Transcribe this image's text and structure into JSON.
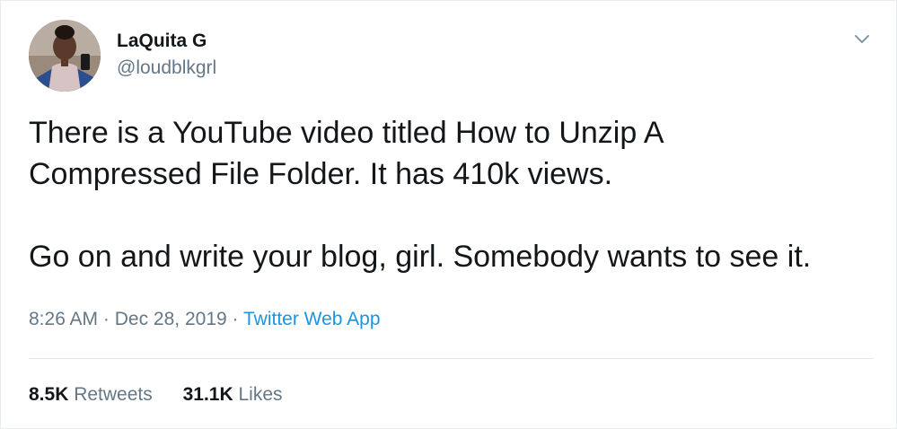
{
  "user": {
    "display_name": "LaQuita G",
    "handle": "@loudblkgrl"
  },
  "tweet": {
    "lines_paragraph_1": [
      "There is a YouTube video titled How to Unzip A",
      "Compressed File Folder. It has 410k views."
    ],
    "paragraph_2": "Go on and write your blog, girl. Somebody wants to see it.",
    "time": "8:26 AM",
    "separator": "·",
    "date": "Dec 28, 2019",
    "source": "Twitter Web App"
  },
  "stats": {
    "retweets_count": "8.5K",
    "retweets_label": "Retweets",
    "likes_count": "31.1K",
    "likes_label": "Likes"
  },
  "icons": {
    "more_menu": "chevron-down-icon"
  },
  "colors": {
    "text_primary": "#14171a",
    "text_secondary": "#657786",
    "link": "#1b95e0",
    "divider": "#e1e8ed"
  }
}
